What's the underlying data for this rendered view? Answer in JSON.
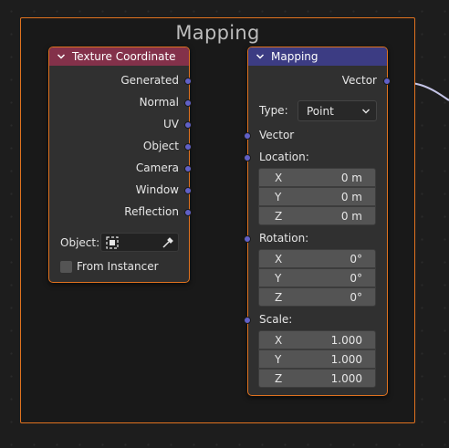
{
  "frame": {
    "title": "Mapping"
  },
  "texcoord": {
    "title": "Texture Coordinate",
    "header_color": "#83314a",
    "outputs": [
      "Generated",
      "Normal",
      "UV",
      "Object",
      "Camera",
      "Window",
      "Reflection"
    ],
    "object_label": "Object:",
    "from_instancer": "From Instancer"
  },
  "mapping": {
    "title": "Mapping",
    "header_color": "#3c3c83",
    "output_label": "Vector",
    "type_label": "Type:",
    "type_value": "Point",
    "vector_input": "Vector",
    "location": {
      "label": "Location:",
      "x": "0 m",
      "y": "0 m",
      "z": "0 m"
    },
    "rotation": {
      "label": "Rotation:",
      "x": "0°",
      "y": "0°",
      "z": "0°"
    },
    "scale": {
      "label": "Scale:",
      "x": "1.000",
      "y": "1.000",
      "z": "1.000"
    },
    "axis": {
      "x": "X",
      "y": "Y",
      "z": "Z"
    }
  },
  "colors": {
    "socket_vector": "#6161c7",
    "frame_border": "#e0721f",
    "link": "#c4c4e6"
  }
}
